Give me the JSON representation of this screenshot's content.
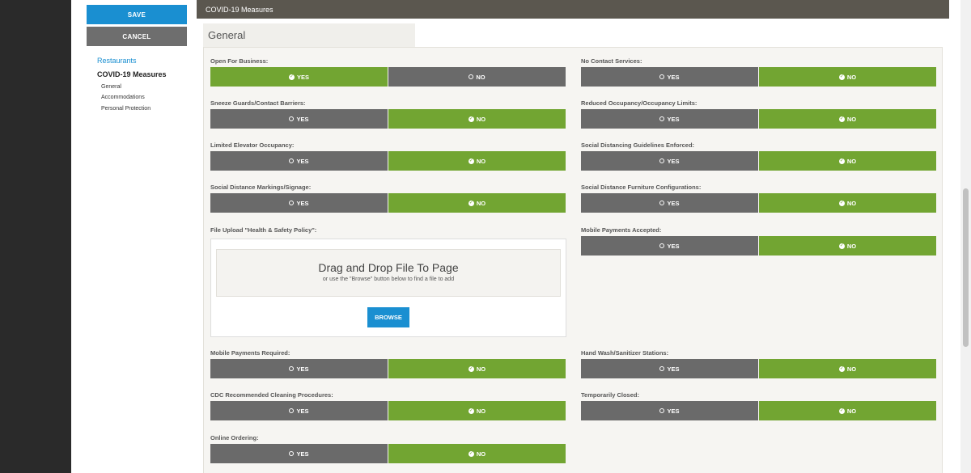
{
  "sidebar": {
    "save_label": "SAVE",
    "cancel_label": "CANCEL",
    "link_restaurants": "Restaurants",
    "active_section": "COVID-19 Measures",
    "subitems": [
      "General",
      "Accommodations",
      "Personal Protection"
    ]
  },
  "header": {
    "title": "COVID-19 Measures"
  },
  "section": {
    "title": "General"
  },
  "options": {
    "yes": "YES",
    "no": "NO"
  },
  "fields": [
    {
      "label": "Open For Business:",
      "value": "yes"
    },
    {
      "label": "No Contact Services:",
      "value": "no"
    },
    {
      "label": "Sneeze Guards/Contact Barriers:",
      "value": "no"
    },
    {
      "label": "Reduced Occupancy/Occupancy Limits:",
      "value": "no"
    },
    {
      "label": "Limited Elevator Occupancy:",
      "value": "no"
    },
    {
      "label": "Social Distancing Guidelines Enforced:",
      "value": "no"
    },
    {
      "label": "Social Distance Markings/Signage:",
      "value": "no"
    },
    {
      "label": "Social Distance Furniture Configurations:",
      "value": "no"
    },
    {
      "label": "Mobile Payments Accepted:",
      "value": "no"
    },
    {
      "label": "Mobile Payments Required:",
      "value": "no"
    },
    {
      "label": "Hand Wash/Sanitizer Stations:",
      "value": "no"
    },
    {
      "label": "CDC Recommended Cleaning Procedures:",
      "value": "no"
    },
    {
      "label": "Temporarily Closed:",
      "value": "no"
    },
    {
      "label": "Online Ordering:",
      "value": "no"
    }
  ],
  "upload": {
    "label": "File Upload \"Health & Safety Policy\":",
    "drop_title": "Drag and Drop File To Page",
    "drop_subtitle": "or use the \"Browse\" button below to find a file to add",
    "browse_label": "BROWSE"
  },
  "colors": {
    "selected": "#72a532",
    "unselected": "#6a6a6a",
    "primary": "#1a8fd1",
    "header_bar": "#5b574f"
  }
}
